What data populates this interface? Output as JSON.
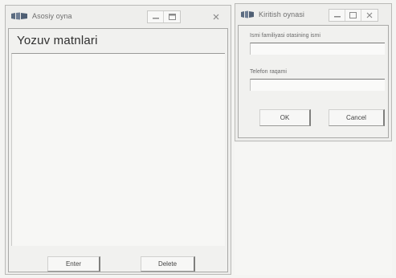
{
  "main_window": {
    "title": "Asosiy oyna",
    "heading": "Yozuv matnlari",
    "textarea_value": "",
    "buttons": {
      "enter_label": "Enter",
      "delete_label": "Delete"
    },
    "controls": {
      "minimize_icon": "minimize-icon",
      "maximize_icon": "maximize-icon",
      "close_icon": "close-icon"
    }
  },
  "input_window": {
    "title": "Kiritish oynasi",
    "fields": [
      {
        "label": "Ismi familiyasi otasining ismi",
        "value": ""
      },
      {
        "label": "Telefon raqami",
        "value": ""
      }
    ],
    "buttons": {
      "ok_label": "OK",
      "cancel_label": "Cancel"
    }
  },
  "colors": {
    "window_bg": "#eeeeec",
    "border": "#b9b9b6",
    "text": "#333333",
    "logo": "#5b6b80"
  }
}
